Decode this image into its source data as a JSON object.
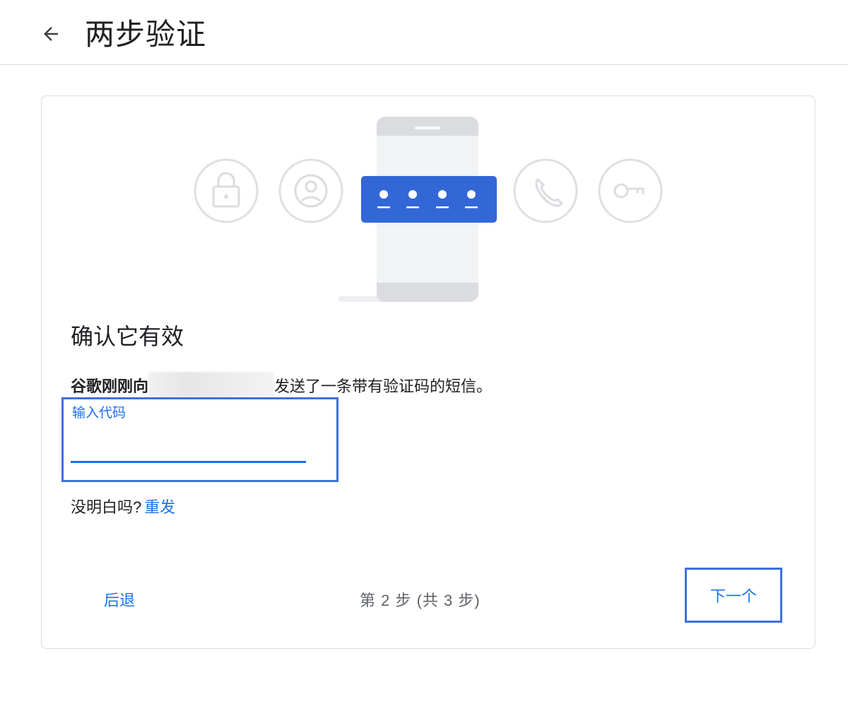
{
  "header": {
    "title": "两步验证",
    "back_icon": "arrow-left-icon"
  },
  "illustration": {
    "icons": [
      "lock-icon",
      "account-icon",
      "phone-icon",
      "key-icon"
    ],
    "code_placeholder": "••••",
    "accent_color": "#3367d6"
  },
  "main": {
    "heading": "确认它有效",
    "info_prefix": "谷歌刚刚向",
    "info_suffix": "发送了一条带有验证码的短信。",
    "code_field": {
      "label": "输入代码",
      "value": "",
      "placeholder": ""
    },
    "resend_prompt": "没明白吗?",
    "resend_link": "重发"
  },
  "footer": {
    "back_label": "后退",
    "step_text": "第 2 步 (共 3 步)",
    "next_label": "下一个"
  },
  "colors": {
    "link": "#1a73e8",
    "highlight_border": "#3f6fe0",
    "divider": "#dadce0"
  }
}
